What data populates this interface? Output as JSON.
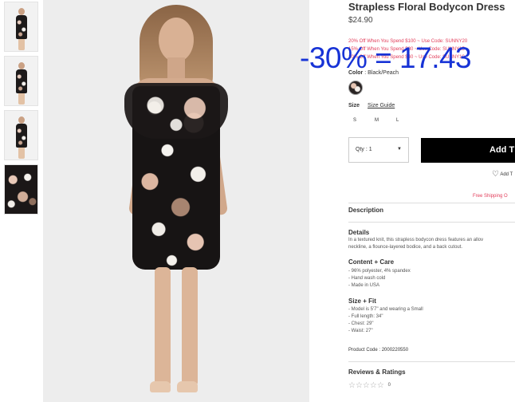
{
  "product": {
    "title": "Strapless Floral Bodycon Dress",
    "price": "$24.90",
    "promos": [
      "20% Off When You Spend $100 ~ Use Code: SUNNY20",
      "15% Off When You Spend $80 ~ Use Code: SUNNY15",
      "10% Off When You Spend $40 ~ Use Code: SUNNY10"
    ],
    "color_label": "Color",
    "color_value": ": Black/Peach",
    "size_label": "Size",
    "size_guide": "Size Guide",
    "sizes": [
      "S",
      "M",
      "L"
    ],
    "qty_label": "Qty : 1",
    "add_button": "Add T",
    "wishlist": "Add T",
    "shipping": "Free Shipping O",
    "description_title": "Description",
    "details_title": "Details",
    "details_lines": [
      "In a textured knit, this strapless bodycon dress features an allov",
      "neckline, a flounce-layered bodice, and a back cutout."
    ],
    "content_title": "Content + Care",
    "content_lines": [
      "- 96% polyester, 4% spandex",
      "- Hand wash cold",
      "- Made in USA"
    ],
    "fit_title": "Size + Fit",
    "fit_lines": [
      "- Model is 5'7\" and wearing a Small",
      "- Full length: 34\"",
      "- Chest: 29\"",
      "- Waist: 27\""
    ],
    "product_code": "Product Code : 2000220550",
    "reviews_title": "Reviews & Ratings",
    "rating_stars": "☆☆☆☆☆",
    "review_count": "0"
  },
  "overlay_text": "-30% = 17.43",
  "colors": {
    "accent": "#e23d5a",
    "overlay": "#1733d6",
    "button": "#000000"
  }
}
